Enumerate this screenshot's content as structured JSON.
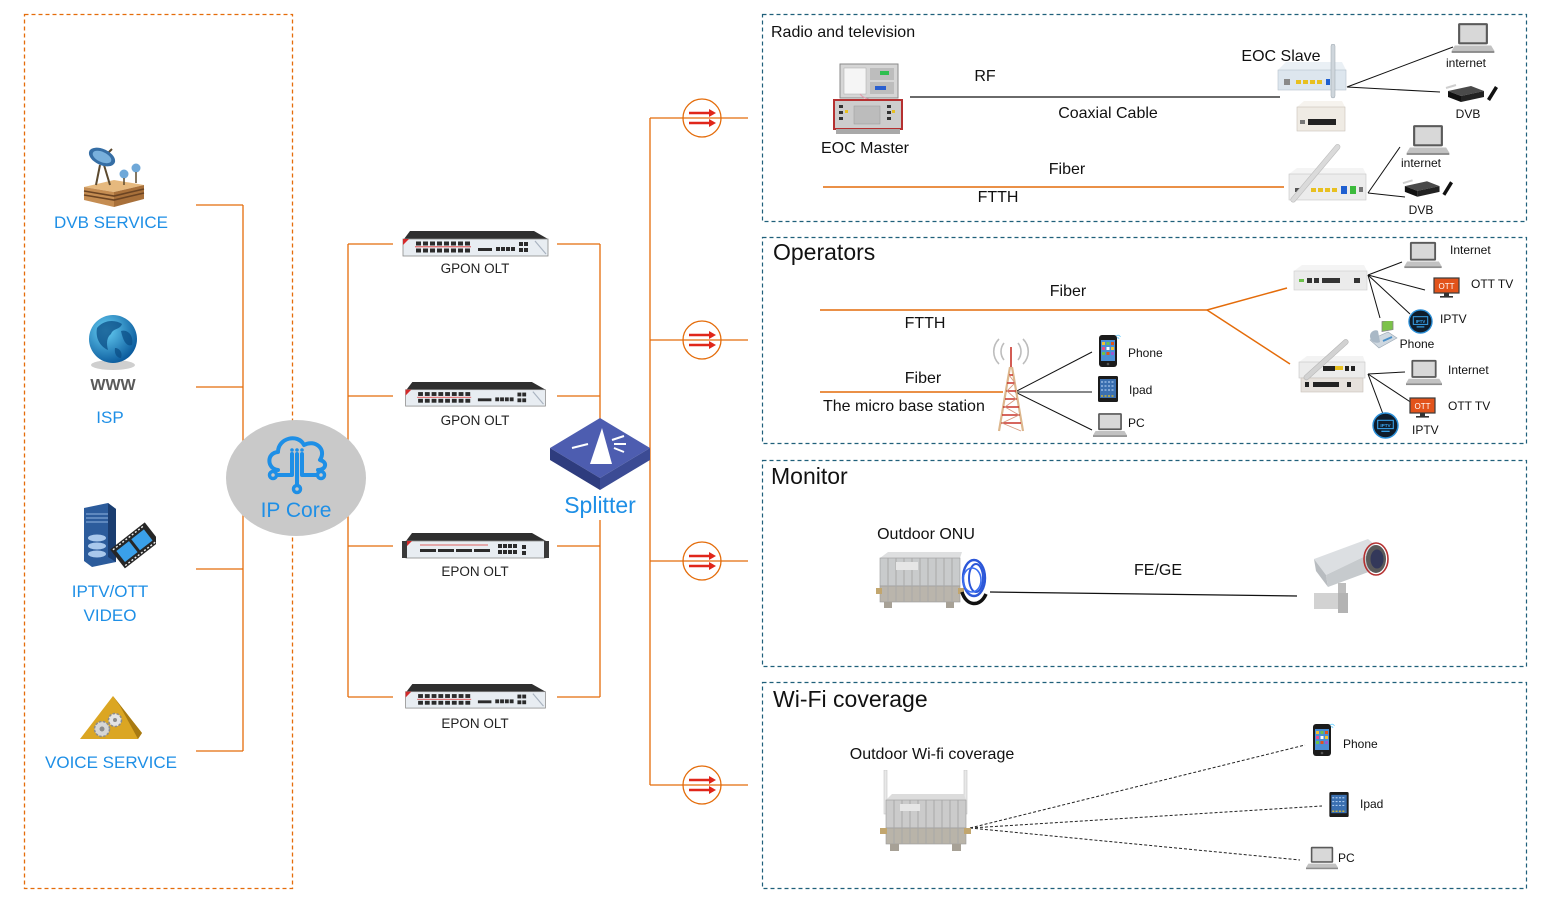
{
  "services": {
    "dvb": {
      "label": "DVB SERVICE"
    },
    "isp": {
      "badge": "WWW",
      "label": "ISP"
    },
    "iptv": {
      "label_line1": "IPTV/OTT",
      "label_line2": "VIDEO"
    },
    "voice": {
      "label": "VOICE SERVICE"
    }
  },
  "core": {
    "label": "IP Core"
  },
  "olts": [
    {
      "label": "GPON OLT"
    },
    {
      "label": "GPON OLT"
    },
    {
      "label": "EPON OLT"
    },
    {
      "label": "EPON OLT"
    }
  ],
  "splitter": {
    "label": "Splitter"
  },
  "panels": {
    "radio_tv": {
      "title": "Radio and television",
      "master_label": "EOC Master",
      "rf_label": "RF",
      "coax_label": "Coaxial Cable",
      "slave_label": "EOC Slave",
      "fiber_label": "Fiber",
      "ftth_label": "FTTH",
      "slave_devices": [
        "internet",
        "DVB"
      ],
      "ont_devices": [
        "internet",
        "DVB"
      ]
    },
    "operators": {
      "title": "Operators",
      "fiber_label_1": "Fiber",
      "ftth_label": "FTTH",
      "fiber_label_2": "Fiber",
      "base_station_label": "The micro base station",
      "station_devices": [
        "Phone",
        "Ipad",
        "PC"
      ],
      "ont1_devices": [
        "Internet",
        "OTT TV",
        "IPTV",
        "Phone"
      ],
      "ont2_devices": [
        "Internet",
        "OTT TV",
        "IPTV"
      ]
    },
    "monitor": {
      "title": "Monitor",
      "onu_label": "Outdoor ONU",
      "link_label": "FE/GE"
    },
    "wifi": {
      "title": "Wi-Fi coverage",
      "ap_label": "Outdoor Wi-fi coverage",
      "devices": [
        "Phone",
        "Ipad",
        "PC"
      ]
    }
  },
  "badges": {
    "ott": "OTT",
    "iptv": "IPTV"
  },
  "colors": {
    "accent_blue": "#1e8fe6",
    "connector_orange": "#e46c0a",
    "panel_border": "#1f5f7a",
    "core_gray": "#c9c9c9",
    "arrow_red": "#e0261a"
  }
}
